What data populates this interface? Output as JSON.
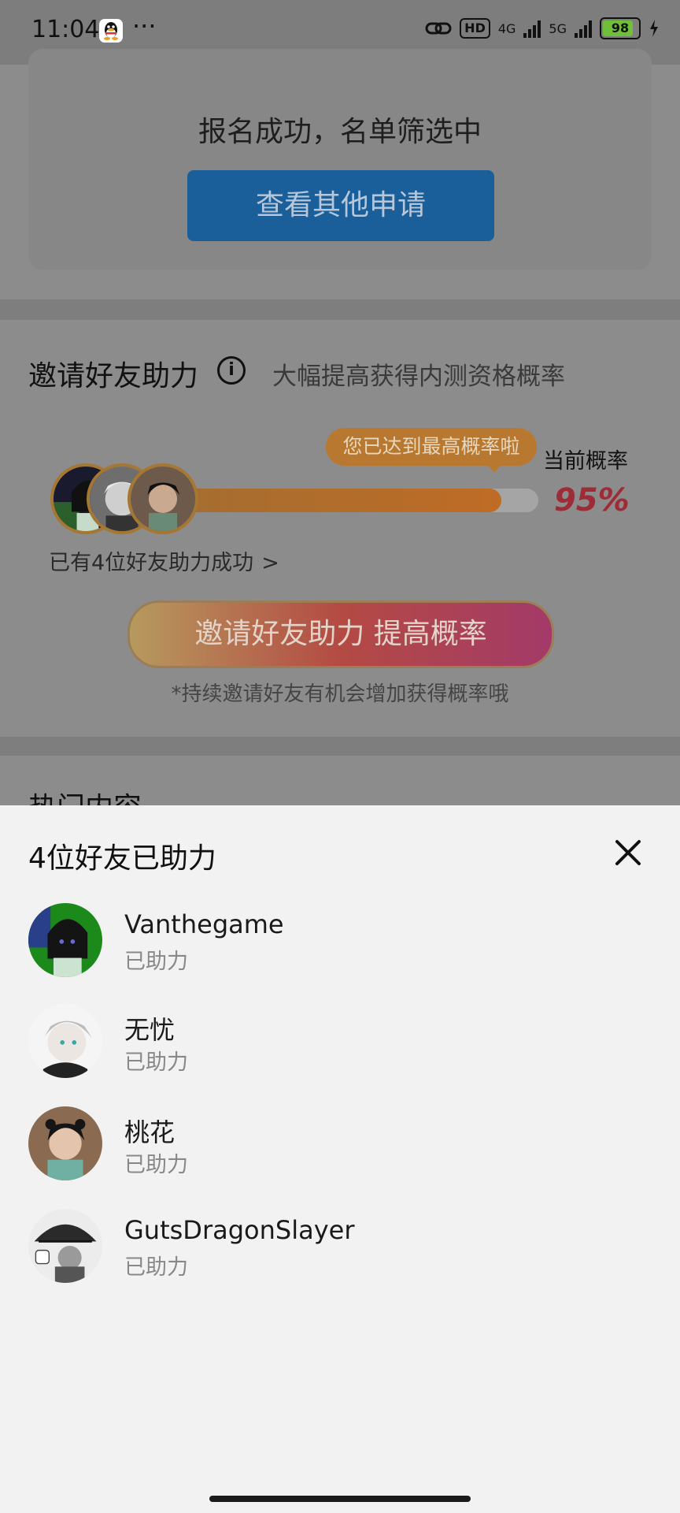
{
  "status_bar": {
    "time": "11:04",
    "more": "···",
    "net_hd": "HD",
    "net_4g": "4G",
    "net_5g": "5G",
    "battery": "98"
  },
  "result_card": {
    "title": "报名成功，名单筛选中",
    "button": "查看其他申请"
  },
  "invite_section": {
    "title": "邀请好友助力",
    "info_icon": "i",
    "subtitle": "大幅提高获得内测资格概率",
    "bubble": "您已达到最高概率啦",
    "current_label": "当前概率",
    "percent": "95%",
    "progress": 0.92,
    "helped_link": "已有4位好友助力成功",
    "helped_chevron": ">",
    "invite_button": "邀请好友助力 提高概率",
    "tip": "*持续邀请好友有机会增加获得概率哦",
    "next_section_peek": "热门内容"
  },
  "sheet": {
    "title": "4位好友已助力",
    "close_icon": "close-icon",
    "friends": [
      {
        "name": "Vanthegame",
        "status": "已助力"
      },
      {
        "name": "无忧",
        "status": "已助力"
      },
      {
        "name": "桃花",
        "status": "已助力"
      },
      {
        "name": "GutsDragonSlayer",
        "status": "已助力"
      }
    ]
  },
  "colors": {
    "primary_blue": "#1a5f9a",
    "progress_orange": "#bf6c25",
    "percent_red": "#9e2b35",
    "sheet_bg": "#f2f2f2"
  }
}
